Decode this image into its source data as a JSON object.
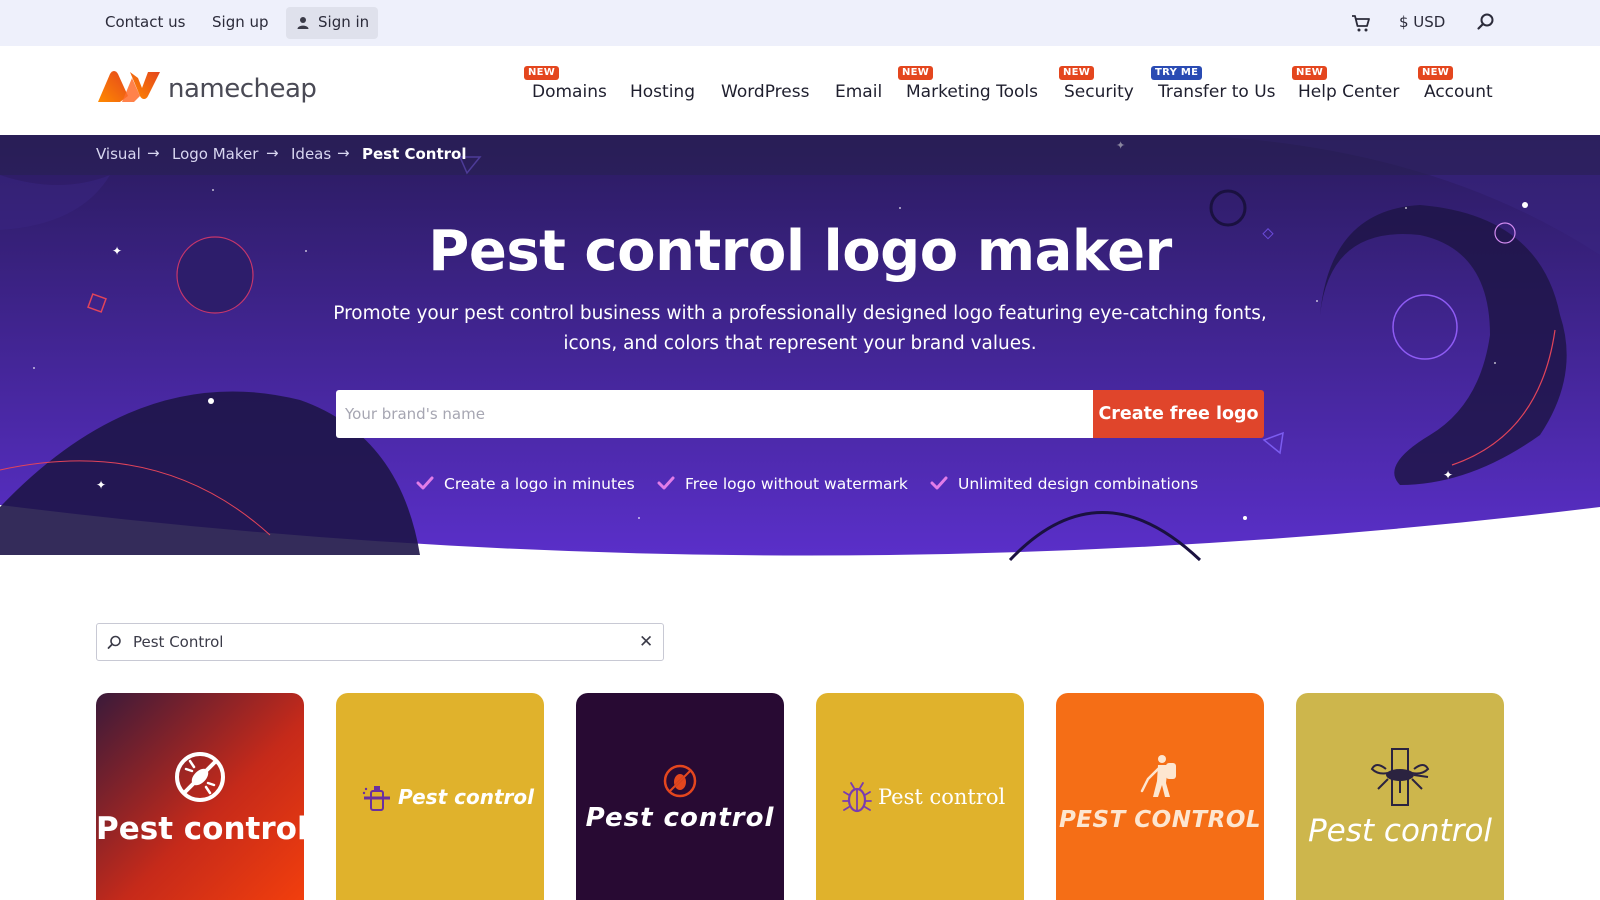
{
  "topbar": {
    "contact": "Contact us",
    "signup": "Sign up",
    "signin": "Sign in",
    "currency": "$ USD",
    "icons": [
      "user-icon",
      "cart-icon",
      "search-icon"
    ]
  },
  "header": {
    "brand": "namecheap",
    "nav": [
      {
        "label": "Domains",
        "badge": "NEW"
      },
      {
        "label": "Hosting",
        "badge": ""
      },
      {
        "label": "WordPress",
        "badge": ""
      },
      {
        "label": "Email",
        "badge": ""
      },
      {
        "label": "Marketing Tools",
        "badge": "NEW"
      },
      {
        "label": "Security",
        "badge": "NEW"
      },
      {
        "label": "Transfer to Us",
        "badge": "TRY ME"
      },
      {
        "label": "Help Center",
        "badge": "NEW"
      },
      {
        "label": "Account",
        "badge": "NEW"
      }
    ]
  },
  "breadcrumb": [
    "Visual",
    "Logo Maker",
    "Ideas",
    "Pest Control"
  ],
  "hero": {
    "title": "Pest control logo maker",
    "subtitle": "Promote your pest control business with a professionally designed logo featuring eye-catching fonts, icons, and colors that represent your brand values.",
    "input_placeholder": "Your brand's name",
    "button": "Create free logo",
    "features": [
      "Create a logo in minutes",
      "Free logo without watermark",
      "Unlimited design combinations"
    ]
  },
  "search": {
    "value": "Pest Control"
  },
  "cards": [
    {
      "text": "Pest control",
      "icon": "no-bug-icon",
      "bg": "#e4461e"
    },
    {
      "text": "Pest control",
      "icon": "spray-icon",
      "bg": "#e0b22c"
    },
    {
      "text": "Pest control",
      "icon": "bug-in-circle-icon",
      "bg": "#280a33"
    },
    {
      "text": "Pest control",
      "icon": "beetle-icon",
      "bg": "#e0b22c"
    },
    {
      "text": "PEST CONTROL",
      "icon": "exterminator-icon",
      "bg": "#f56e16"
    },
    {
      "text": "Pest control",
      "icon": "mosquito-icon",
      "bg": "#cdb64c"
    }
  ],
  "colors": {
    "accent": "#e0452b",
    "hero_start": "#2a1b5e",
    "hero_end": "#5a2fc9",
    "badge": "#e4461e",
    "badge_blue": "#2a4bb3"
  }
}
